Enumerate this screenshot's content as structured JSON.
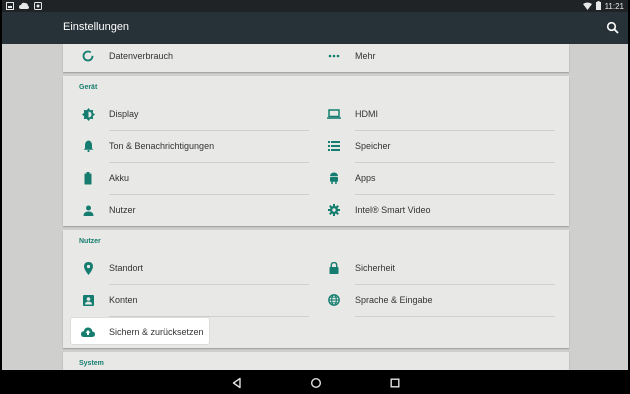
{
  "statusbar": {
    "time": "11:21"
  },
  "appbar": {
    "title": "Einstellungen"
  },
  "top_row": [
    {
      "label": "Datenverbrauch",
      "icon": "data-usage-icon"
    },
    {
      "label": "Mehr",
      "icon": "more-dots-icon"
    }
  ],
  "sections": [
    {
      "title": "Gerät",
      "items": [
        {
          "label": "Display",
          "icon": "brightness-icon"
        },
        {
          "label": "HDMI",
          "icon": "laptop-icon"
        },
        {
          "label": "Ton & Benachrichtigungen",
          "icon": "bell-icon"
        },
        {
          "label": "Speicher",
          "icon": "storage-list-icon"
        },
        {
          "label": "Akku",
          "icon": "battery-icon"
        },
        {
          "label": "Apps",
          "icon": "android-icon"
        },
        {
          "label": "Nutzer",
          "icon": "person-icon"
        },
        {
          "label": "Intel® Smart Video",
          "icon": "gear-icon"
        }
      ]
    },
    {
      "title": "Nutzer",
      "items": [
        {
          "label": "Standort",
          "icon": "location-pin-icon"
        },
        {
          "label": "Sicherheit",
          "icon": "lock-icon"
        },
        {
          "label": "Konten",
          "icon": "account-box-icon"
        },
        {
          "label": "Sprache & Eingabe",
          "icon": "globe-icon"
        },
        {
          "label": "Sichern & zurücksetzen",
          "icon": "cloud-upload-icon"
        }
      ]
    },
    {
      "title": "System",
      "items": []
    }
  ],
  "colors": {
    "accent": "#147d6f",
    "appbar": "#263238",
    "background": "#cfcfcd",
    "card": "#e8e8e6"
  }
}
